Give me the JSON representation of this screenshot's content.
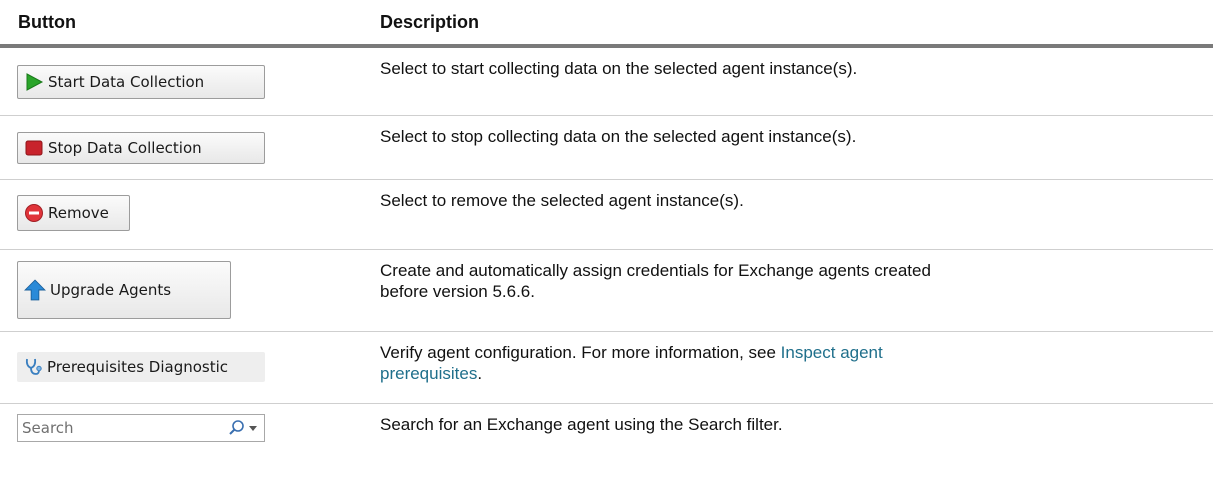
{
  "header": {
    "button": "Button",
    "description": "Description"
  },
  "rows": [
    {
      "button_label": "Start Data Collection",
      "button_icon": "play-icon",
      "description": "Select to start collecting data on the selected agent instance(s)."
    },
    {
      "button_label": "Stop Data Collection",
      "button_icon": "stop-icon",
      "description": "Select to stop collecting data on the selected agent instance(s)."
    },
    {
      "button_label": "Remove",
      "button_icon": "remove-icon",
      "description": "Select to remove the selected agent instance(s)."
    },
    {
      "button_label": "Upgrade Agents",
      "button_icon": "arrow-up-icon",
      "description_line1": "Create and automatically assign credentials for Exchange agents created",
      "description_line2": "before version 5.6.6."
    },
    {
      "button_label": "Prerequisites Diagnostic",
      "button_icon": "stethoscope-icon",
      "description_prefix": "Verify agent configuration. For more information, see ",
      "link_line1": "Inspect agent",
      "link_line2": "prerequisites",
      "description_suffix": "."
    },
    {
      "search_placeholder": "Search",
      "description": "Search for an Exchange agent using the Search filter."
    }
  ],
  "colors": {
    "link": "#1f6f8b",
    "play_green": "#2aa52a",
    "stop_red": "#c8232c",
    "remove_red": "#e0343a",
    "upgrade_blue": "#2a8ad8",
    "header_rule": "#7a7a7a"
  }
}
